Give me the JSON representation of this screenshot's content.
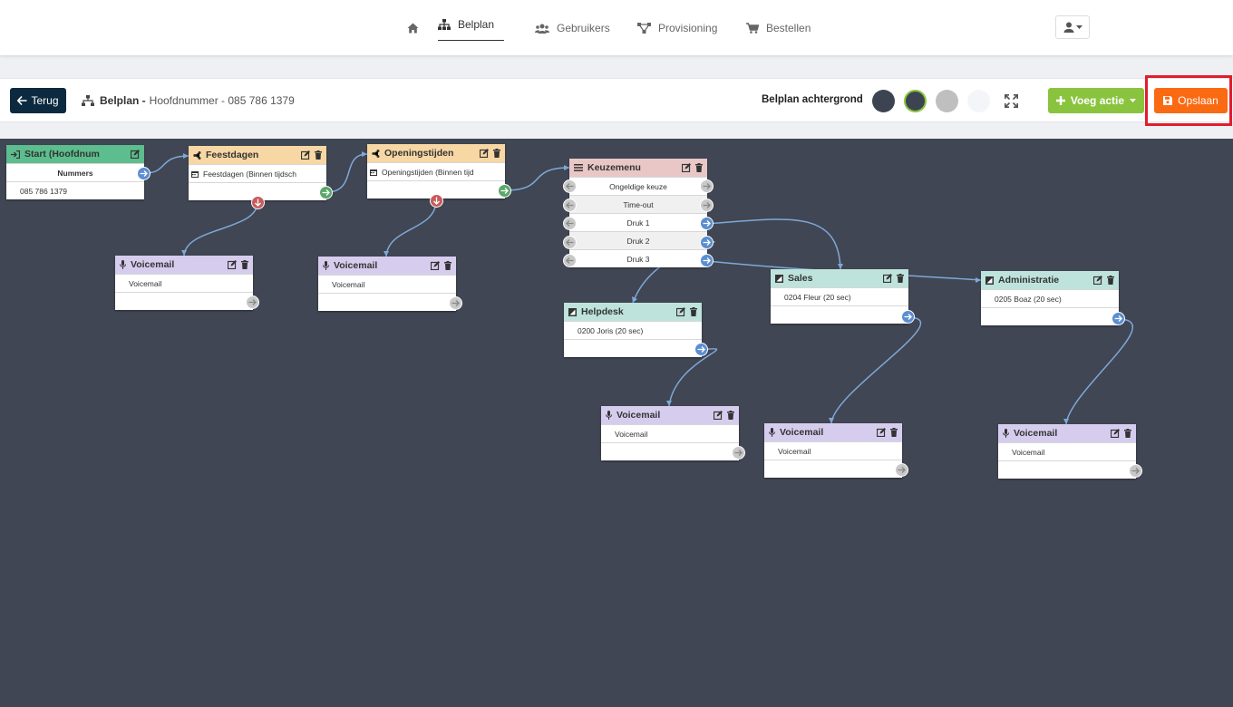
{
  "nav": {
    "items": [
      {
        "label": ""
      },
      {
        "label": "Belplan"
      },
      {
        "label": "Gebruikers"
      },
      {
        "label": "Provisioning"
      },
      {
        "label": "Bestellen"
      }
    ]
  },
  "toolbar": {
    "back_label": "Terug",
    "crumb_title": "Belplan -",
    "crumb_sub": "Hoofdnummer - 085 786 1379",
    "bg_label": "Belplan achtergrond",
    "swatches": [
      "#3d4451",
      "#3d4451",
      "#bfbfbf",
      "#f4f5f8"
    ],
    "add_label": "Voeg actie",
    "save_label": "Opslaan"
  },
  "colors": {
    "start": "#5cbd8e",
    "feestdagen": "#f7d7a4",
    "openingstijden": "#f7d7a4",
    "keuzemenu": "#e9c7c7",
    "voicemail": "#d6cdee",
    "group": "#bde3dc",
    "canvas": "#404653",
    "wire": "#7fa8d8"
  },
  "nodes": {
    "start": {
      "title": "Start (Hoofdnum",
      "rows": [
        "Nummers",
        "085 786 1379"
      ]
    },
    "feestdagen": {
      "title": "Feestdagen",
      "rows": [
        "Feestdagen (Binnen tijdsch",
        ""
      ]
    },
    "openingstijden": {
      "title": "Openingstijden",
      "rows": [
        "Openingstijden (Binnen tijd",
        ""
      ]
    },
    "keuzemenu": {
      "title": "Keuzemenu",
      "rows": [
        "Ongeldige keuze",
        "Time-out",
        "Druk 1",
        "Druk 2",
        "Druk 3"
      ]
    },
    "voicemail1": {
      "title": "Voicemail",
      "rows": [
        "Voicemail",
        ""
      ]
    },
    "voicemail2": {
      "title": "Voicemail",
      "rows": [
        "Voicemail",
        ""
      ]
    },
    "helpdesk": {
      "title": "Helpdesk",
      "rows": [
        "0200 Joris (20 sec)",
        ""
      ]
    },
    "sales": {
      "title": "Sales",
      "rows": [
        "0204 Fleur (20 sec)",
        ""
      ]
    },
    "administratie": {
      "title": "Administratie",
      "rows": [
        "0205 Boaz (20 sec)",
        ""
      ]
    },
    "voicemail3": {
      "title": "Voicemail",
      "rows": [
        "Voicemail",
        ""
      ]
    },
    "voicemail4": {
      "title": "Voicemail",
      "rows": [
        "Voicemail",
        ""
      ]
    },
    "voicemail5": {
      "title": "Voicemail",
      "rows": [
        "Voicemail",
        ""
      ]
    }
  }
}
